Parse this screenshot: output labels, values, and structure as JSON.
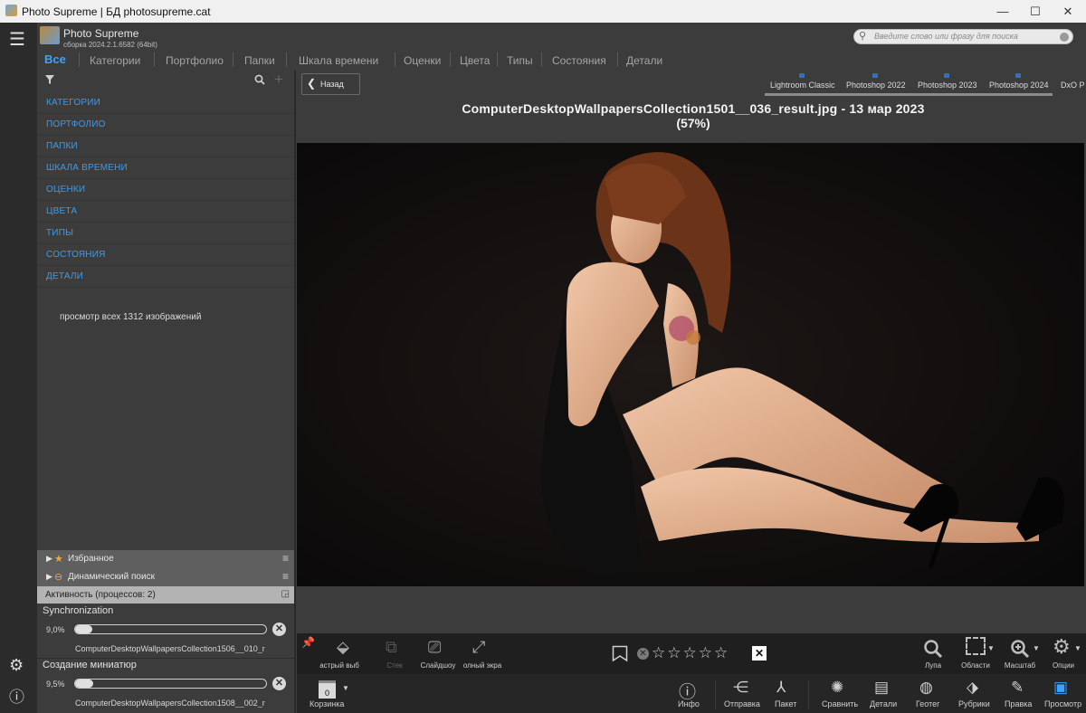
{
  "window": {
    "title": "Photo Supreme | БД photosupreme.cat",
    "minimize": "—",
    "maximize": "☐",
    "close": "✕"
  },
  "app": {
    "name": "Photo Supreme",
    "build": "сборка 2024.2.1.6582 (64bit)"
  },
  "tabs": [
    "Все",
    "Категории",
    "Портфолио",
    "Папки",
    "Шкала времени",
    "Оценки",
    "Цвета",
    "Типы",
    "Состояния",
    "Детали"
  ],
  "search": {
    "placeholder": "Введите слово или фразу для поиска"
  },
  "categories": [
    "КАТЕГОРИИ",
    "ПОРТФОЛИО",
    "ПАПКИ",
    "ШКАЛА ВРЕМЕНИ",
    "ОЦЕНКИ",
    "ЦВЕТА",
    "ТИПЫ",
    "СОСТОЯНИЯ",
    "ДЕТАЛИ"
  ],
  "view_all": "просмотр всех 1312 изображений",
  "sections": {
    "favorites": "Избранное",
    "dynamic": "Динамический поиск",
    "activity": "Активность (процессов: 2)"
  },
  "processes": [
    {
      "name": "Synchronization",
      "pct_label": "9,0%",
      "progress": 0.09,
      "file": "ComputerDesktopWallpapersCollection1506__010_r"
    },
    {
      "name": "Создание миниатюр",
      "pct_label": "9,5%",
      "progress": 0.095,
      "file": "ComputerDesktopWallpapersCollection1508__002_r"
    }
  ],
  "back_button": "Назад",
  "externals": [
    "Lightroom Classic",
    "Photoshop 2022",
    "Photoshop 2023",
    "Photoshop 2024",
    "DxO P"
  ],
  "image": {
    "title_line1": "ComputerDesktopWallpapersCollection1501__036_result.jpg  -  13 мар 2023",
    "title_line2": "(57%)"
  },
  "toolbar": {
    "quick": "астрый выб",
    "stack": "Стек",
    "slideshow": "Слайдшоу",
    "fullscreen": "олный экра",
    "loupe": "Лупа",
    "regions": "Области",
    "zoom": "Масштаб",
    "options": "Опции",
    "rating": 0
  },
  "bottombar": {
    "basket_count": "0",
    "basket": "Корзинка",
    "info": "Инфо",
    "send": "Отправка",
    "batch": "Пакет",
    "compare": "Сравнить",
    "details": "Детали",
    "geotag": "Геотег",
    "rubrics": "Рубрики",
    "edit": "Правка",
    "view": "Просмотр"
  }
}
